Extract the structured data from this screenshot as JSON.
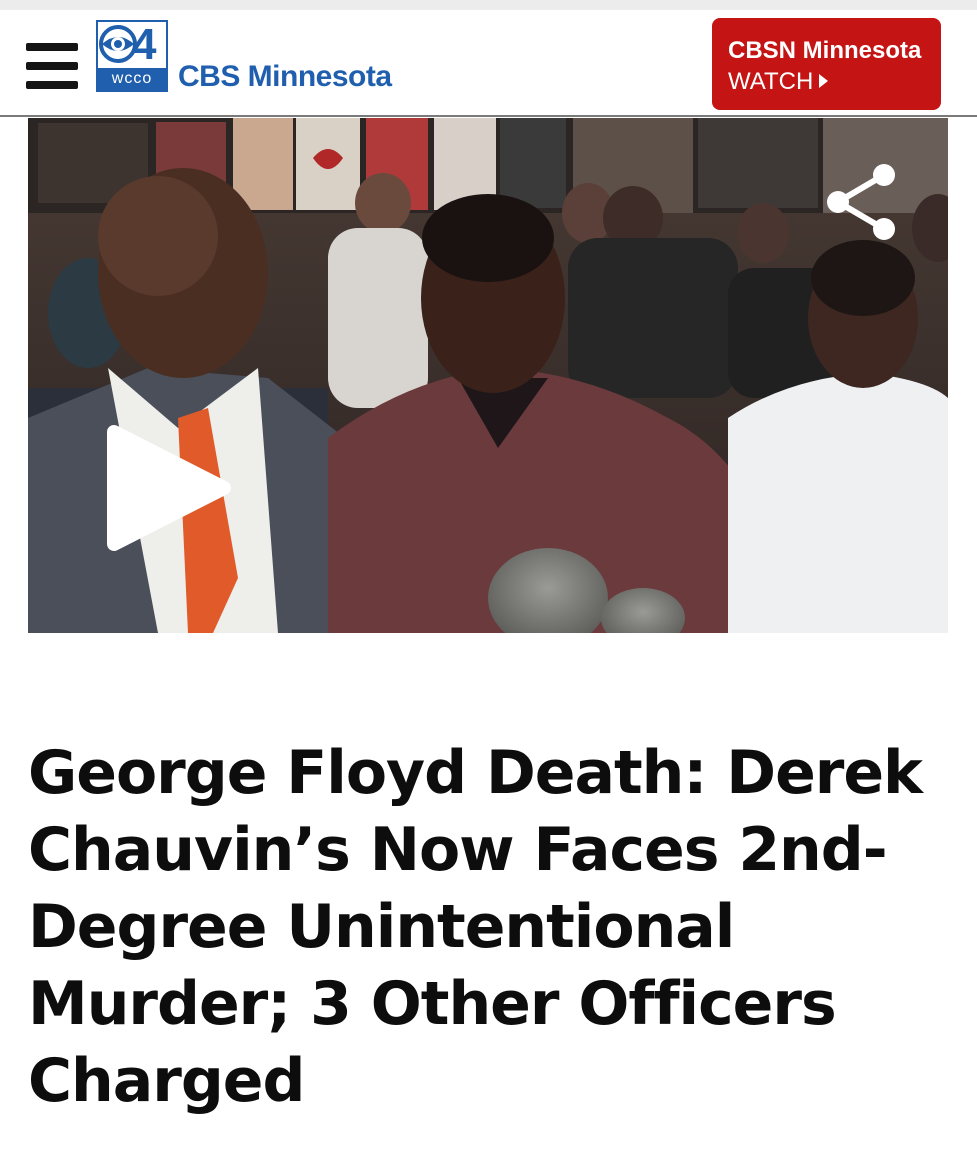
{
  "header": {
    "menu_icon": "hamburger-menu-icon",
    "logo": {
      "channel_number": "4",
      "call_sign": "wcco",
      "brand": "CBS Minnesota"
    },
    "watch_button": {
      "title": "CBSN Minnesota",
      "action": "WATCH",
      "icon": "play-caret-icon",
      "color": "#c41414"
    },
    "brand_color": "#1f5fae"
  },
  "video": {
    "play_icon": "play-icon",
    "share_icon": "share-icon"
  },
  "article": {
    "headline": "George Floyd Death: Derek Chauvin’s Now Faces 2nd-Degree Unintentional Murder; 3 Other Officers Charged"
  }
}
